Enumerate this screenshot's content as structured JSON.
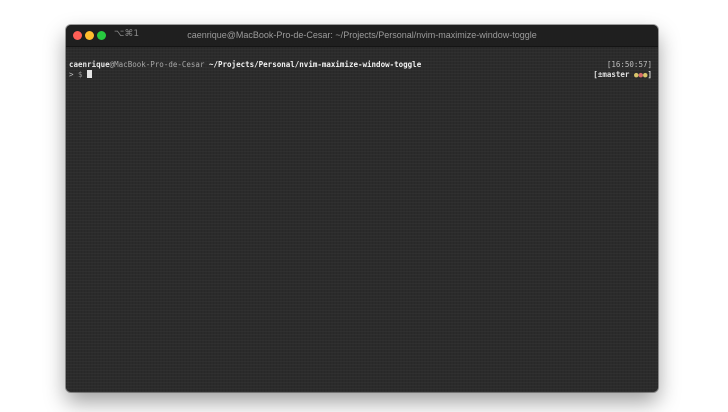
{
  "window": {
    "shortcut": "⌥⌘1",
    "title": "caenrique@MacBook-Pro-de-Cesar: ~/Projects/Personal/nvim-maximize-window-toggle",
    "traffic_colors": {
      "close": "#ff5f56",
      "minimize": "#ffbd2e",
      "zoom": "#27c93f"
    }
  },
  "terminal": {
    "user": "caenrique",
    "host": "@MacBook-Pro-de-Cesar",
    "path": "~/Projects/Personal/nvim-maximize-window-toggle",
    "time": "[16:50:57]",
    "prompt_arrow": ">",
    "prompt_symbol": "$",
    "git_open": "[",
    "git_branch_icon": "±",
    "git_branch": "master",
    "git_close": "]",
    "git_dots": [
      {
        "glyph": "●",
        "color": "#d7c46a"
      },
      {
        "glyph": "●",
        "color": "#d86a6a"
      },
      {
        "glyph": "●",
        "color": "#d7c46a"
      }
    ]
  }
}
